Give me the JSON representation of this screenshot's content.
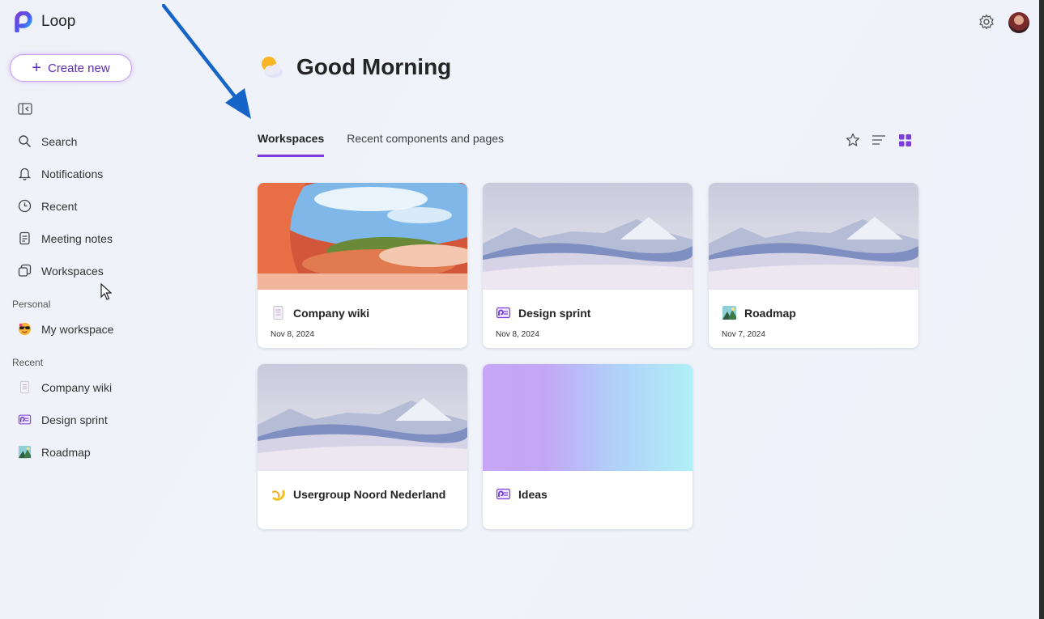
{
  "app": {
    "name": "Loop"
  },
  "sidebar": {
    "create_label": "Create new",
    "nav": [
      {
        "label": "Search",
        "icon": "search-icon"
      },
      {
        "label": "Notifications",
        "icon": "bell-icon"
      },
      {
        "label": "Recent",
        "icon": "clock-icon"
      },
      {
        "label": "Meeting notes",
        "icon": "notes-icon"
      },
      {
        "label": "Workspaces",
        "icon": "workspaces-icon"
      }
    ],
    "personal_label": "Personal",
    "personal_items": [
      {
        "label": "My workspace",
        "icon": "sunglasses-emoji-icon"
      }
    ],
    "recent_label": "Recent",
    "recent_items": [
      {
        "label": "Company wiki",
        "icon": "document-icon"
      },
      {
        "label": "Design sprint",
        "icon": "loop-page-icon"
      },
      {
        "label": "Roadmap",
        "icon": "landscape-icon"
      }
    ]
  },
  "main": {
    "greeting": "Good Morning",
    "greeting_icon": "sun-behind-cloud-icon",
    "tabs": [
      {
        "label": "Workspaces",
        "active": true
      },
      {
        "label": "Recent components and pages",
        "active": false
      }
    ],
    "view_tools": [
      "star-icon",
      "list-view-icon",
      "grid-view-icon"
    ],
    "accent_color": "#7b3ed8",
    "cards": [
      {
        "title": "Company wiki",
        "date": "Nov 8, 2024",
        "icon": "document-icon",
        "cover": "orange-architecture"
      },
      {
        "title": "Design sprint",
        "date": "Nov 8, 2024",
        "icon": "loop-page-icon",
        "cover": "desert-dunes"
      },
      {
        "title": "Roadmap",
        "date": "Nov 7, 2024",
        "icon": "landscape-icon",
        "cover": "desert-dunes"
      },
      {
        "title": "Usergroup Noord Nederland",
        "date": "",
        "icon": "lemon-icon",
        "cover": "desert-dunes"
      },
      {
        "title": "Ideas",
        "date": "",
        "icon": "loop-page-icon",
        "cover": "purple-cyan-gradient"
      }
    ]
  }
}
